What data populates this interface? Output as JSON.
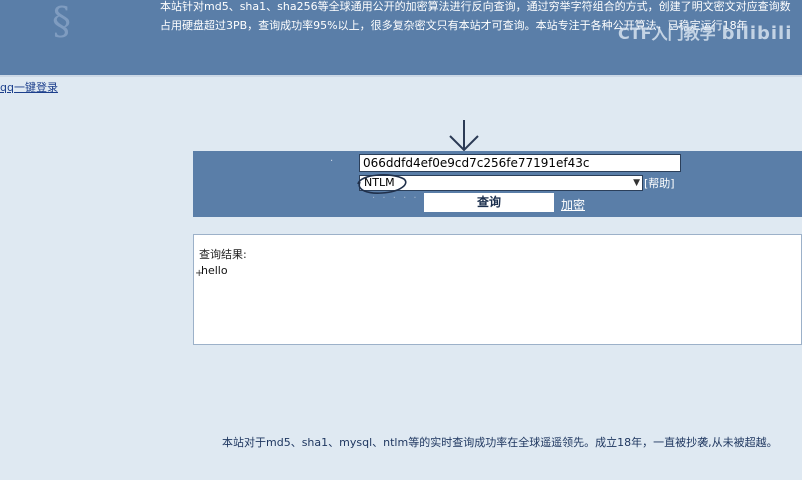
{
  "header": {
    "logo_glyph": "§",
    "intro_line1": "本站针对md5、sha1、sha256等全球通用公开的加密算法进行反向查询，通过穷举字符组合的方式，创建了明文密文对应查询数",
    "intro_line2": "占用硬盘超过3PB，查询成功率95%以上，很多复杂密文只有本站才可查询。本站专注于各种公开算法，已稳定运行18年",
    "watermark_text": "CTF入门教学",
    "watermark_brand": "bilibili"
  },
  "nav": {
    "qq_login": "qq一键登录"
  },
  "query": {
    "hash_value": "066ddfd4ef0e9cd7c256fe77191ef43c",
    "hash_type": "NTLM",
    "help_label": "[帮助]",
    "dots": "· · · · ·",
    "submit_label": "查询",
    "encrypt_label": "加密"
  },
  "result": {
    "label": "查询结果:",
    "cursor": "+",
    "value": "hello"
  },
  "footer": {
    "note": "本站对于md5、sha1、mysql、ntlm等的实时查询成功率在全球遥遥领先。成立18年，一直被抄袭,从未被超越。"
  },
  "colors": {
    "panel": "#5a7ea8",
    "background": "#dfe9f2",
    "link": "#1c3f8c"
  },
  "annotations": {
    "arrow_icon": "down-arrow-icon",
    "circle_icon": "circle-highlight-icon"
  }
}
